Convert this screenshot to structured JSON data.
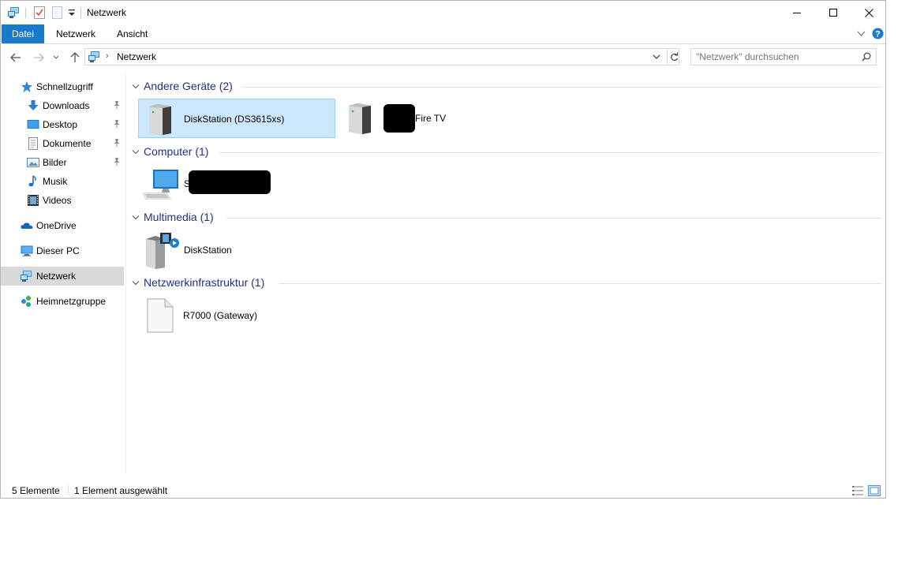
{
  "window": {
    "title": "Netzwerk"
  },
  "ribbon": {
    "tabs": [
      "Datei",
      "Netzwerk",
      "Ansicht"
    ]
  },
  "address": {
    "breadcrumb": "Netzwerk"
  },
  "search": {
    "placeholder": "\"Netzwerk\" durchsuchen"
  },
  "sidebar": {
    "items": [
      {
        "label": "Schnellzugriff",
        "icon": "star-icon"
      },
      {
        "label": "Downloads",
        "icon": "download-icon",
        "pinned": true
      },
      {
        "label": "Desktop",
        "icon": "desktop-icon",
        "pinned": true
      },
      {
        "label": "Dokumente",
        "icon": "documents-icon",
        "pinned": true
      },
      {
        "label": "Bilder",
        "icon": "pictures-icon",
        "pinned": true
      },
      {
        "label": "Musik",
        "icon": "music-icon"
      },
      {
        "label": "Videos",
        "icon": "videos-icon"
      },
      {
        "label": "OneDrive",
        "icon": "cloud-icon"
      },
      {
        "label": "Dieser PC",
        "icon": "computer-icon"
      },
      {
        "label": "Netzwerk",
        "icon": "network-icon",
        "selected": true
      },
      {
        "label": "Heimnetzgruppe",
        "icon": "homegroup-icon"
      }
    ]
  },
  "groups": [
    {
      "title": "Andere Geräte (2)",
      "items": [
        {
          "label": "DiskStation (DS3615xs)",
          "icon": "server-icon",
          "selected": true
        },
        {
          "label": "Fire TV",
          "icon": "server-icon",
          "redacted": true
        }
      ]
    },
    {
      "title": "Computer (1)",
      "items": [
        {
          "label": "S",
          "icon": "pc-icon",
          "redacted": true
        }
      ]
    },
    {
      "title": "Multimedia (1)",
      "items": [
        {
          "label": "DiskStation",
          "icon": "media-server-icon"
        }
      ]
    },
    {
      "title": "Netzwerkinfrastruktur (1)",
      "items": [
        {
          "label": "R7000 (Gateway)",
          "icon": "device-icon"
        }
      ]
    }
  ],
  "status": {
    "count": "5 Elemente",
    "selection": "1 Element ausgewählt"
  },
  "colors": {
    "accent": "#1979ca",
    "group_title": "#1e3287",
    "selection_bg": "#cce8ff",
    "selection_border": "#99d1ff"
  }
}
